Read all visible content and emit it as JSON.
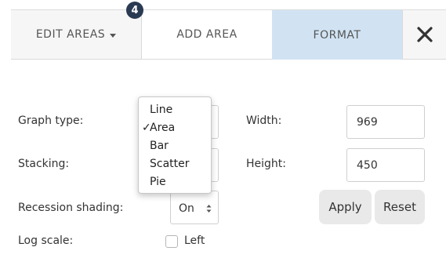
{
  "tabs": {
    "edit_areas": "EDIT AREAS",
    "edit_areas_count": "4",
    "add_area": "ADD AREA",
    "format": "FORMAT",
    "close_icon": "close-icon"
  },
  "form": {
    "graph_type_label": "Graph type:",
    "stacking_label": "Stacking:",
    "recession_label": "Recession shading:",
    "recession_value": "On",
    "log_scale_label": "Log scale:",
    "log_left_label": "Left",
    "width_label": "Width:",
    "width_value": "969",
    "height_label": "Height:",
    "height_value": "450",
    "apply": "Apply",
    "reset": "Reset"
  },
  "graph_type_menu": {
    "check_mark": "✓",
    "selected": "Area",
    "options": [
      "Line",
      "Area",
      "Bar",
      "Scatter",
      "Pie"
    ]
  },
  "colors": {
    "format_tab_bg": "#d1e3f3",
    "badge_bg": "#2a3a52",
    "button_bg": "#e9e9e9"
  }
}
